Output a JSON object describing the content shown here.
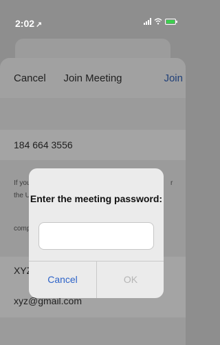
{
  "status": {
    "time": "2:02",
    "location_arrow": "↗"
  },
  "nav": {
    "cancel": "Cancel",
    "title": "Join Meeting",
    "join": "Join"
  },
  "meeting_id": "184 664 3556",
  "notes": {
    "line1": "If you",
    "line1_end": "r",
    "line2": "the UF",
    "line3": "compa"
  },
  "name": "XYZ",
  "email": "xyz@gmail.com",
  "dialog": {
    "title": "Enter the meeting password:",
    "password_value": "",
    "cancel": "Cancel",
    "ok": "OK"
  },
  "icons": [
    "signal-icon",
    "wifi-icon",
    "battery-icon",
    "location-arrow-icon"
  ],
  "colors": {
    "accent": "#2d63c8",
    "overlay": "#8e8e8e",
    "battery_charge": "#3ccf4e"
  }
}
